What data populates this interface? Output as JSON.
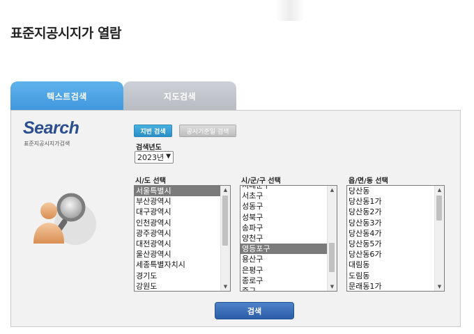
{
  "page": {
    "title": "표준지공시지가 열람"
  },
  "tabs": [
    {
      "label": "텍스트검색",
      "active": true
    },
    {
      "label": "지도검색",
      "active": false
    }
  ],
  "logo": {
    "title": "Search",
    "subtitle": "표준지공시지가검색"
  },
  "mode_buttons": {
    "jibeon": "지번 검색",
    "gongsi": "공시기준일 검색"
  },
  "year": {
    "label": "검색년도",
    "selected": "2023년"
  },
  "sido": {
    "label": "시/도 선택",
    "items": [
      "서울특별시",
      "부산광역시",
      "대구광역시",
      "인천광역시",
      "광주광역시",
      "대전광역시",
      "울산광역시",
      "세종특별자치시",
      "경기도",
      "강원도"
    ],
    "selected_index": 0
  },
  "sigungu": {
    "label": "시/군/구 선택",
    "items": [
      "서대문구",
      "서초구",
      "성동구",
      "성북구",
      "송파구",
      "양천구",
      "영등포구",
      "용산구",
      "은평구",
      "종로구",
      "중구"
    ],
    "selected_index": 6
  },
  "eupmyeondong": {
    "label": "읍/면/동 선택",
    "items": [
      "당산동",
      "당산동1가",
      "당산동2가",
      "당산동3가",
      "당산동4가",
      "당산동5가",
      "당산동6가",
      "대림동",
      "도림동",
      "문래동1가"
    ],
    "selected_index": -1
  },
  "search_button": "검색",
  "colors": {
    "active_tab": "#4fa6e6",
    "selected_row": "#7b7b7b",
    "search_button": "#3a6fba"
  }
}
